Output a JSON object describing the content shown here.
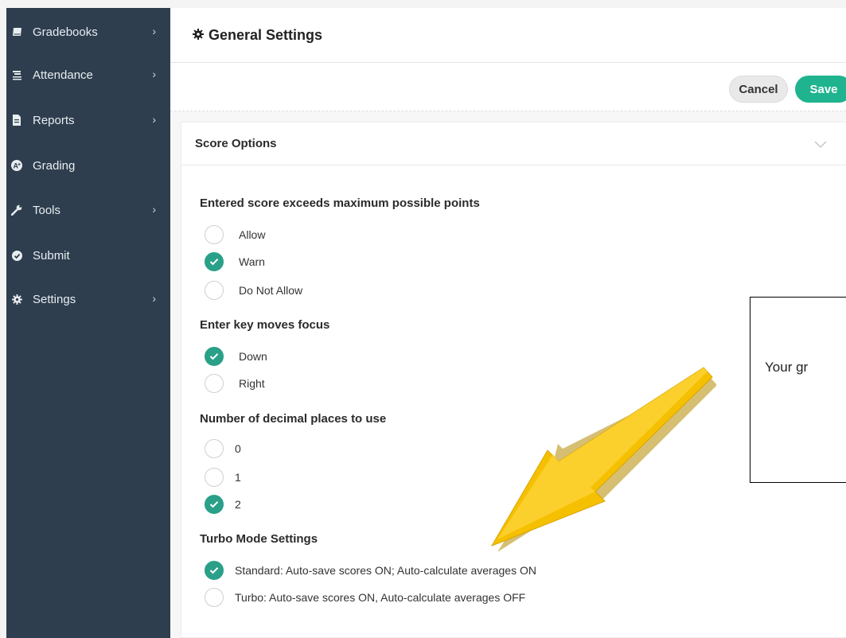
{
  "sidebar": {
    "items": [
      {
        "label": "Gradebooks",
        "icon": "book-icon",
        "has_submenu": true
      },
      {
        "label": "Attendance",
        "icon": "attendance-icon",
        "has_submenu": true
      },
      {
        "label": "Reports",
        "icon": "document-icon",
        "has_submenu": true
      },
      {
        "label": "Grading",
        "icon": "grade-badge-icon",
        "has_submenu": false
      },
      {
        "label": "Tools",
        "icon": "wrench-icon",
        "has_submenu": true
      },
      {
        "label": "Submit",
        "icon": "check-circle-icon",
        "has_submenu": false
      },
      {
        "label": "Settings",
        "icon": "gear-icon",
        "has_submenu": true
      }
    ]
  },
  "header": {
    "title": "General Settings",
    "icon": "gear-icon"
  },
  "actions": {
    "cancel_label": "Cancel",
    "save_label": "Save"
  },
  "panel": {
    "title": "Score Options",
    "groups": [
      {
        "label": "Entered score exceeds maximum possible points",
        "options": [
          {
            "label": "Allow",
            "checked": false
          },
          {
            "label": "Warn",
            "checked": true
          },
          {
            "label": "Do Not Allow",
            "checked": false
          }
        ]
      },
      {
        "label": "Enter key moves focus",
        "options": [
          {
            "label": "Down",
            "checked": true
          },
          {
            "label": "Right",
            "checked": false
          }
        ]
      },
      {
        "label": "Number of decimal places to use",
        "options": [
          {
            "label": "0",
            "checked": false
          },
          {
            "label": "1",
            "checked": false
          },
          {
            "label": "2",
            "checked": true
          }
        ]
      },
      {
        "label": "Turbo Mode Settings",
        "options": [
          {
            "label": "Standard: Auto-save scores ON; Auto-calculate averages ON",
            "checked": true
          },
          {
            "label": "Turbo: Auto-save scores ON, Auto-calculate averages OFF",
            "checked": false
          }
        ]
      }
    ]
  },
  "callout": {
    "text": "Your gr"
  },
  "colors": {
    "sidebar": "#2e3e4e",
    "accent": "#1fb48f",
    "radio_checked": "#2aa088",
    "arrow": "#f5c000"
  }
}
